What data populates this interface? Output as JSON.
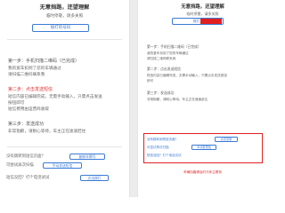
{
  "left": {
    "title": "无意挡路，还望理解",
    "subtitle": "临时停靠，请多关照",
    "number_button": "拨打的号码",
    "step1_title": "第一步：手机扫描二维码（已完成）",
    "step1_lines": [
      "我的爱车扣到了您的车辆通过",
      "请扫描二维码联系我"
    ],
    "step2_title": "第二步：点击发送短信",
    "step2_lines": [
      "短信内容已编辑完成，无需手动输入，只需点击发送",
      "按钮即可",
      "短信费用由运营商收取"
    ],
    "step3_title": "第三步：发送成功",
    "step3_lines": [
      "非常抱歉，请耐心等待，车主正在速速赶往"
    ],
    "footer": {
      "q1": "没有跳转到短信页面？",
      "q1_button": "复制车牌号",
      "q2": "可尝试再次扫描",
      "q2_button": "手动发送短信",
      "q3": "短信没回？打个电话试试",
      "q3_button": "点击拨打"
    }
  },
  "right": {
    "title": "无意挡路，还望理解",
    "subtitle": "临时停靠，请多关照",
    "number_button": "拨打1",
    "step1_title": "第一步：手机扫描二维码（已完成）",
    "step1_lines": [
      "我的爱车扣到了您的车辆通过",
      "请扫描二维码联系我"
    ],
    "step2_title": "第二步：点击发送短信",
    "step2_lines": [
      "短信内容已编辑完成，无需手动输入，只需点击发送按钮",
      "即可"
    ],
    "step3_title": "第三步：发送成功",
    "step3_lines": [
      "非常抱歉，请耐心等待，车主正在速速赶往"
    ],
    "footer": {
      "q1": "没有跳转到短信页面？",
      "q1_button": "点击复制",
      "q2": "可尝试再次扫描",
      "q2_button": "手动发短信",
      "q3": "短信没回？打个电话试试"
    },
    "warning": "车辆挡路请及时与车主联系"
  },
  "colors": {
    "accent": "#3a7bd5",
    "highlight": "#e02020",
    "step2_red": "#e03333"
  }
}
